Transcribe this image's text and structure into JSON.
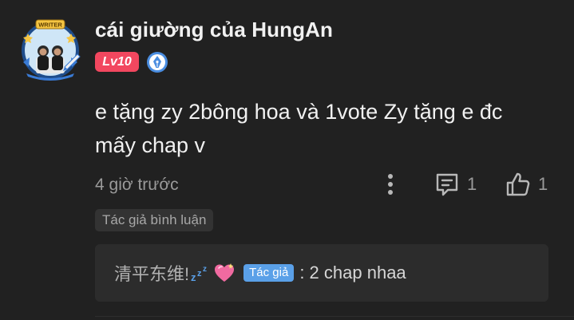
{
  "comment": {
    "username": "cái giường của HungAn",
    "level_badge": "Lv10",
    "avatar_frame_label": "WRITER",
    "content": "e tặng zy 2bông hoa và 1vote Zy tặng e đc mấy chap v",
    "timestamp": "4 giờ trước",
    "reply_count": "1",
    "like_count": "1",
    "author_tag": "Tác giả bình luận",
    "icons": {
      "verified": "verified-pen-icon",
      "more": "more-vertical-icon",
      "reply": "comment-icon",
      "like": "thumbs-up-icon"
    },
    "colors": {
      "background": "#212121",
      "level_badge": "#f2475f",
      "verified": "#4a8de0",
      "author_chip": "#5aa0e8"
    }
  },
  "reply": {
    "author": "清平东维!",
    "emojis": [
      "sleeping-zzz-icon",
      "heart-icon"
    ],
    "author_chip": "Tác giả",
    "text": ": 2 chap nhaa"
  }
}
